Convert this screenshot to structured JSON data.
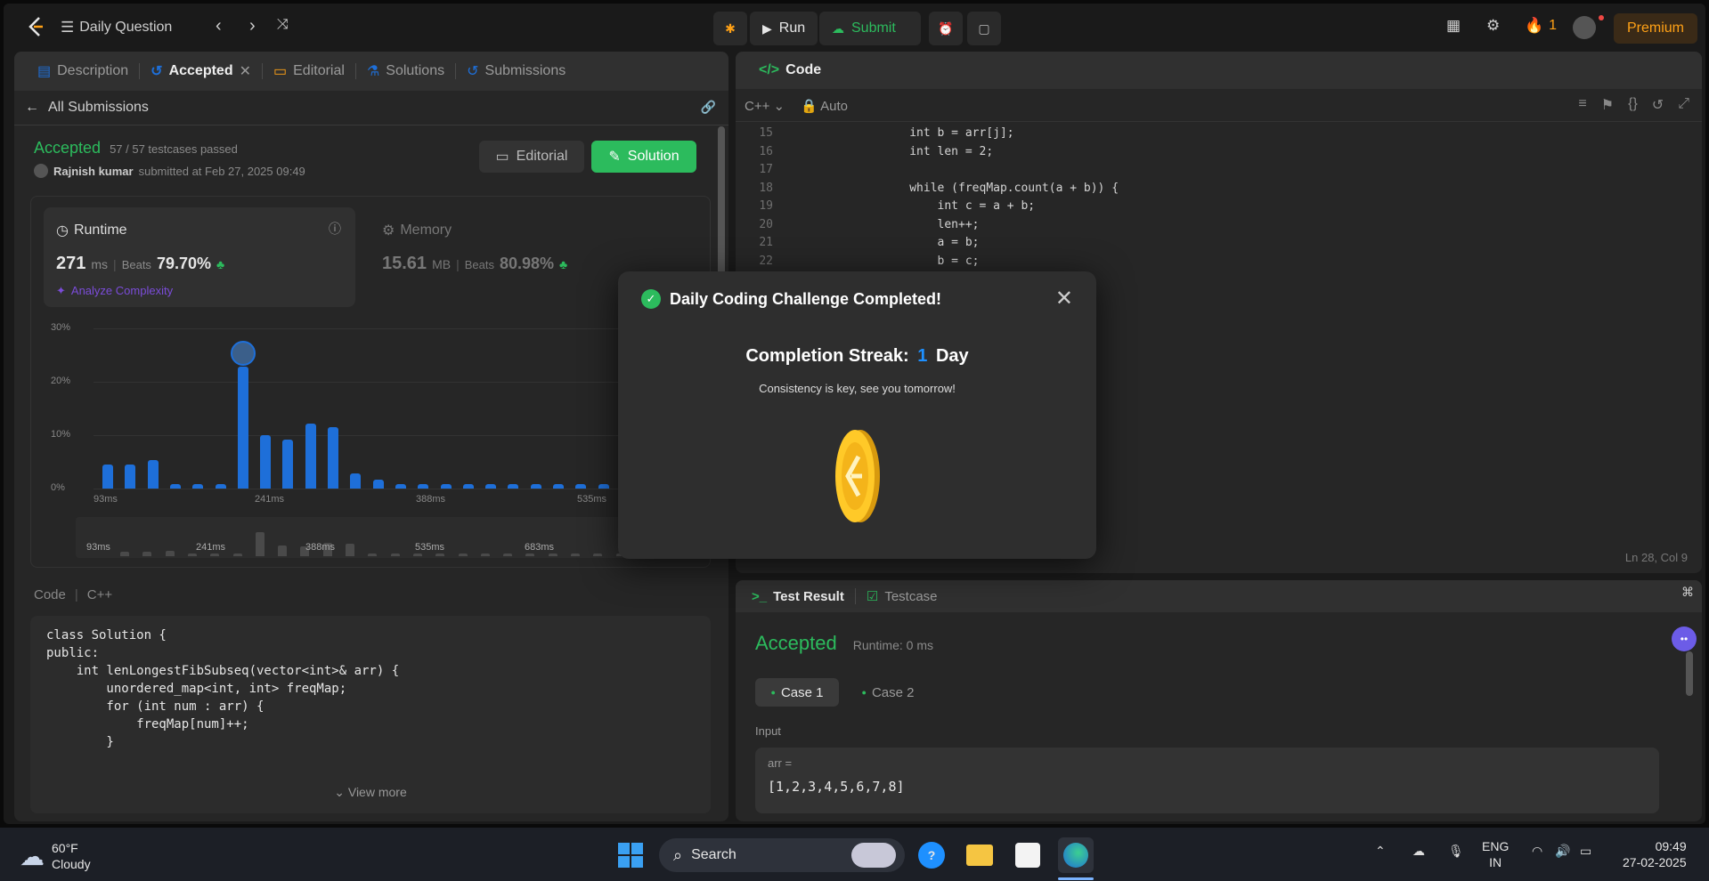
{
  "topbar": {
    "title": "Daily Question",
    "run": "Run",
    "submit": "Submit",
    "streak": "1",
    "premium": "Premium"
  },
  "left": {
    "tabs": [
      {
        "label": "Description"
      },
      {
        "label": "Accepted"
      },
      {
        "label": "Editorial"
      },
      {
        "label": "Solutions"
      },
      {
        "label": "Submissions"
      }
    ],
    "back": "All Submissions",
    "status": "Accepted",
    "testcases": "57 / 57 testcases passed",
    "user": "Rajnish kumar",
    "submitted": "submitted at Feb 27, 2025 09:49",
    "editorial_btn": "Editorial",
    "solution_btn": "Solution",
    "runtime": {
      "label": "Runtime",
      "value": "271",
      "unit": "ms",
      "beats_label": "Beats",
      "beats": "79.70%",
      "analyze": "Analyze Complexity"
    },
    "memory": {
      "label": "Memory",
      "value": "15.61",
      "unit": "MB",
      "beats_label": "Beats",
      "beats": "80.98%"
    },
    "code_label": "Code",
    "lang": "C++",
    "view_more": "View more"
  },
  "chart_data": {
    "type": "bar",
    "ylabels": [
      "30%",
      "20%",
      "10%",
      "0%"
    ],
    "xticks": [
      "93ms",
      "241ms",
      "388ms",
      "535ms",
      "683ms"
    ],
    "values": [
      4.5,
      4.5,
      5.3,
      0.8,
      0.8,
      0.8,
      22.8,
      10,
      9.2,
      12.2,
      11.5,
      2.8,
      1.7,
      0.8,
      0.8,
      0.8,
      0.8,
      0.8,
      0.8,
      0.8,
      0.8,
      0.8,
      0.8,
      0.8,
      0.8
    ],
    "ylim": [
      0,
      30
    ],
    "highlight_index": 6
  },
  "left_code": [
    "class Solution {",
    "public:",
    "    int lenLongestFibSubseq(vector<int>& arr) {",
    "        unordered_map<int, int> freqMap;",
    "        for (int num : arr) {",
    "            freqMap[num]++;",
    "        }"
  ],
  "editor": {
    "title": "Code",
    "lang": "C++",
    "auto": "Auto",
    "status": "Ln 28, Col 9",
    "lines": [
      {
        "n": "15",
        "t": "                int b = arr[j];"
      },
      {
        "n": "16",
        "t": "                int len = 2;"
      },
      {
        "n": "17",
        "t": ""
      },
      {
        "n": "18",
        "t": "                while (freqMap.count(a + b)) {"
      },
      {
        "n": "19",
        "t": "                    int c = a + b;"
      },
      {
        "n": "20",
        "t": "                    len++;"
      },
      {
        "n": "21",
        "t": "                    a = b;"
      },
      {
        "n": "22",
        "t": "                    b = c;"
      }
    ]
  },
  "result": {
    "tab1": "Test Result",
    "tab2": "Testcase",
    "status": "Accepted",
    "runtime": "Runtime: 0 ms",
    "case1": "Case 1",
    "case2": "Case 2",
    "input_label": "Input",
    "var": "arr =",
    "value": "[1,2,3,4,5,6,7,8]"
  },
  "modal": {
    "title": "Daily Coding Challenge Completed!",
    "streak_label": "Completion Streak:",
    "streak_num": "1",
    "streak_unit": "Day",
    "sub": "Consistency is key, see you tomorrow!"
  },
  "taskbar": {
    "temp": "60°F",
    "weather": "Cloudy",
    "search": "Search",
    "lang1": "ENG",
    "lang2": "IN",
    "time": "09:49",
    "date": "27-02-2025"
  },
  "colors": {
    "accent_green": "#2cbb5d",
    "bar_blue": "#1e6fd9",
    "premium": "#ffa116"
  }
}
